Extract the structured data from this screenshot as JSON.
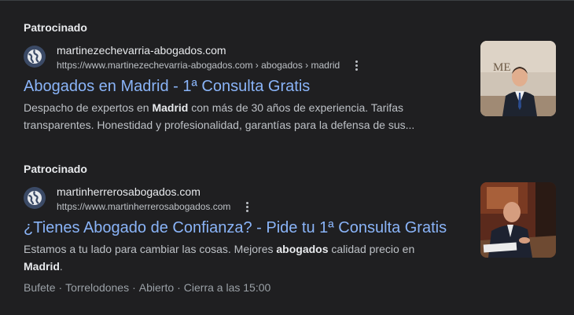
{
  "results": [
    {
      "sponsored_label": "Patrocinado",
      "favicon_icon": "globe-icon",
      "domain": "martinezechevarria-abogados.com",
      "url": "https://www.martinezechevarria-abogados.com › abogados › madrid",
      "title": "Abogados en Madrid - 1ª Consulta Gratis",
      "description": [
        {
          "text": "Despacho de expertos en ",
          "bold": false
        },
        {
          "text": "Madrid",
          "bold": true
        },
        {
          "text": " con más de 30 años de experiencia. Tarifas transparentes. Honestidad y profesionalidad, garantías para la defensa de sus...",
          "bold": false
        }
      ],
      "thumbnail_text": "ME"
    },
    {
      "sponsored_label": "Patrocinado",
      "favicon_icon": "globe-icon",
      "domain": "martinherrerosabogados.com",
      "url": "https://www.martinherrerosabogados.com",
      "title": "¿Tienes Abogado de Confianza? - Pide tu 1ª Consulta Gratis",
      "description": [
        {
          "text": "Estamos a tu lado para cambiar las cosas. Mejores ",
          "bold": false
        },
        {
          "text": "abogados",
          "bold": true
        },
        {
          "text": " calidad precio en ",
          "bold": false
        },
        {
          "text": "Madrid",
          "bold": true
        },
        {
          "text": ".",
          "bold": false
        }
      ],
      "extras": [
        "Bufete",
        "Torrelodones",
        "Abierto",
        "Cierra a las 15:00"
      ]
    }
  ],
  "colors": {
    "background": "#1f1f21",
    "link": "#8ab4f8",
    "text_primary": "#e8eaed",
    "text_secondary": "#bdc1c6",
    "favicon_bg": "#3b4a66"
  }
}
